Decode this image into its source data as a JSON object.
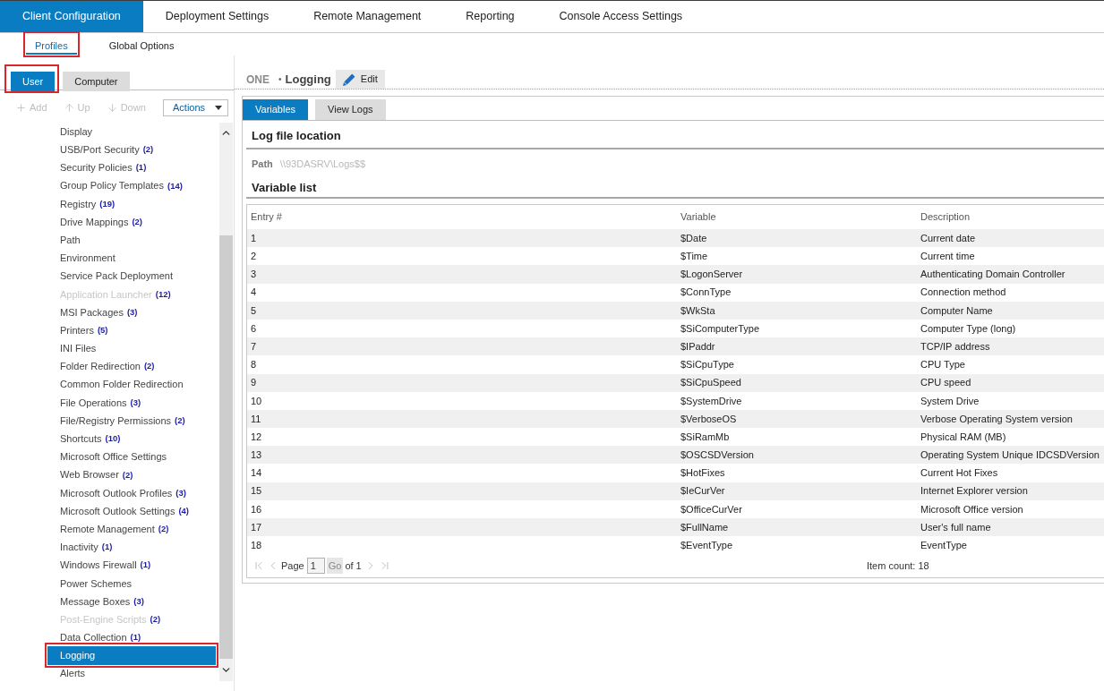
{
  "top_tabs": [
    {
      "label": "Client Configuration",
      "selected": true
    },
    {
      "label": "Deployment Settings",
      "selected": false
    },
    {
      "label": "Remote Management",
      "selected": false
    },
    {
      "label": "Reporting",
      "selected": false
    },
    {
      "label": "Console Access Settings",
      "selected": false
    }
  ],
  "sub_tabs": [
    {
      "label": "Profiles",
      "selected": true,
      "annotated": true
    },
    {
      "label": "Global Options",
      "selected": false,
      "annotated": false
    }
  ],
  "profile_tabs": [
    {
      "label": "User",
      "selected": true,
      "annotated": true
    },
    {
      "label": "Computer",
      "selected": false,
      "annotated": false
    }
  ],
  "toolbar": {
    "buttons": [
      {
        "kind": "add",
        "label": "Add",
        "disabled": true
      },
      {
        "kind": "up",
        "label": "Up",
        "disabled": true
      },
      {
        "kind": "down",
        "label": "Down",
        "disabled": true
      }
    ],
    "actions": {
      "label": "Actions"
    }
  },
  "tree": {
    "items": [
      {
        "label": "Display",
        "selected": false,
        "disabled": false,
        "annotated": false
      },
      {
        "label": "USB/Port Security",
        "count": "(2)",
        "selected": false,
        "disabled": false,
        "annotated": false
      },
      {
        "label": "Security Policies",
        "count": "(1)",
        "selected": false,
        "disabled": false,
        "annotated": false
      },
      {
        "label": "Group Policy Templates",
        "count": "(14)",
        "selected": false,
        "disabled": false,
        "annotated": false
      },
      {
        "label": "Registry",
        "count": "(19)",
        "selected": false,
        "disabled": false,
        "annotated": false
      },
      {
        "label": "Drive Mappings",
        "count": "(2)",
        "selected": false,
        "disabled": false,
        "annotated": false
      },
      {
        "label": "Path",
        "selected": false,
        "disabled": false,
        "annotated": false
      },
      {
        "label": "Environment",
        "selected": false,
        "disabled": false,
        "annotated": false
      },
      {
        "label": "Service Pack Deployment",
        "selected": false,
        "disabled": false,
        "annotated": false
      },
      {
        "label": "Application Launcher",
        "count": "(12)",
        "selected": false,
        "disabled": true,
        "annotated": false
      },
      {
        "label": "MSI Packages",
        "count": "(3)",
        "selected": false,
        "disabled": false,
        "annotated": false
      },
      {
        "label": "Printers",
        "count": "(5)",
        "selected": false,
        "disabled": false,
        "annotated": false
      },
      {
        "label": "INI Files",
        "selected": false,
        "disabled": false,
        "annotated": false
      },
      {
        "label": "Folder Redirection",
        "count": "(2)",
        "selected": false,
        "disabled": false,
        "annotated": false
      },
      {
        "label": "Common Folder Redirection",
        "selected": false,
        "disabled": false,
        "annotated": false
      },
      {
        "label": "File Operations",
        "count": "(3)",
        "selected": false,
        "disabled": false,
        "annotated": false
      },
      {
        "label": "File/Registry Permissions",
        "count": "(2)",
        "selected": false,
        "disabled": false,
        "annotated": false
      },
      {
        "label": "Shortcuts",
        "count": "(10)",
        "selected": false,
        "disabled": false,
        "annotated": false
      },
      {
        "label": "Microsoft Office Settings",
        "selected": false,
        "disabled": false,
        "annotated": false
      },
      {
        "label": "Web Browser",
        "count": "(2)",
        "selected": false,
        "disabled": false,
        "annotated": false
      },
      {
        "label": "Microsoft Outlook Profiles",
        "count": "(3)",
        "selected": false,
        "disabled": false,
        "annotated": false
      },
      {
        "label": "Microsoft Outlook Settings",
        "count": "(4)",
        "selected": false,
        "disabled": false,
        "annotated": false
      },
      {
        "label": "Remote Management",
        "count": "(2)",
        "selected": false,
        "disabled": false,
        "annotated": false
      },
      {
        "label": "Inactivity",
        "count": "(1)",
        "selected": false,
        "disabled": false,
        "annotated": false
      },
      {
        "label": "Windows Firewall",
        "count": "(1)",
        "selected": false,
        "disabled": false,
        "annotated": false
      },
      {
        "label": "Power Schemes",
        "selected": false,
        "disabled": false,
        "annotated": false
      },
      {
        "label": "Message Boxes",
        "count": "(3)",
        "selected": false,
        "disabled": false,
        "annotated": false
      },
      {
        "label": "Post-Engine Scripts",
        "count": "(2)",
        "selected": false,
        "disabled": true,
        "annotated": false
      },
      {
        "label": "Data Collection",
        "count": "(1)",
        "selected": false,
        "disabled": false,
        "annotated": false
      },
      {
        "label": "Logging",
        "selected": true,
        "disabled": false,
        "annotated": true
      },
      {
        "label": "Alerts",
        "selected": false,
        "disabled": false,
        "annotated": false
      }
    ]
  },
  "header": {
    "profile": "ONE",
    "separator": "•",
    "section": "Logging",
    "edit_button": "Edit"
  },
  "content_tabs": [
    {
      "label": "Variables",
      "selected": true
    },
    {
      "label": "View Logs",
      "selected": false
    }
  ],
  "log_file": {
    "title": "Log file location",
    "path_label": "Path",
    "path_value": "\\\\93DASRV\\Logs$$"
  },
  "variable_list": {
    "title": "Variable list",
    "columns": [
      "Entry #",
      "Variable",
      "Description"
    ],
    "rows": [
      [
        "1",
        "$Date",
        "Current date"
      ],
      [
        "2",
        "$Time",
        "Current time"
      ],
      [
        "3",
        "$LogonServer",
        "Authenticating Domain Controller"
      ],
      [
        "4",
        "$ConnType",
        "Connection method"
      ],
      [
        "5",
        "$WkSta",
        "Computer Name"
      ],
      [
        "6",
        "$SiComputerType",
        "Computer Type (long)"
      ],
      [
        "7",
        "$IPaddr",
        "TCP/IP address"
      ],
      [
        "8",
        "$SiCpuType",
        "CPU Type"
      ],
      [
        "9",
        "$SiCpuSpeed",
        "CPU speed"
      ],
      [
        "10",
        "$SystemDrive",
        "System Drive"
      ],
      [
        "11",
        "$VerboseOS",
        "Verbose Operating System version"
      ],
      [
        "12",
        "$SiRamMb",
        "Physical RAM (MB)"
      ],
      [
        "13",
        "$OSCSDVersion",
        "Operating System Unique IDCSDVersion"
      ],
      [
        "14",
        "$HotFixes",
        "Current Hot Fixes"
      ],
      [
        "15",
        "$IeCurVer",
        "Internet Explorer version"
      ],
      [
        "16",
        "$OfficeCurVer",
        "Microsoft Office version"
      ],
      [
        "17",
        "$FullName",
        "User's full name"
      ],
      [
        "18",
        "$EventType",
        "EventType"
      ]
    ]
  },
  "pager": {
    "nav_disabled": true,
    "page_label": "Page",
    "page_value": "1",
    "go_button": "Go",
    "of_text": "of 1",
    "item_count": "Item count: 18"
  }
}
